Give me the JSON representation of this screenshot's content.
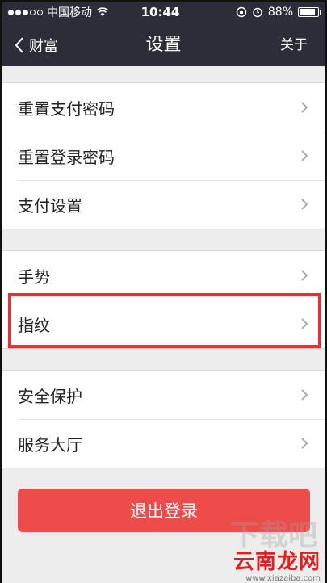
{
  "statusbar": {
    "carrier": "中国移动",
    "time": "10:44",
    "battery": "88%",
    "battery_level": 0.88
  },
  "navbar": {
    "back_label": "财富",
    "title": "设置",
    "about_label": "关于"
  },
  "groups": [
    {
      "items": [
        {
          "label": "重置支付密码"
        },
        {
          "label": "重置登录密码"
        },
        {
          "label": "支付设置"
        }
      ]
    },
    {
      "items": [
        {
          "label": "手势"
        },
        {
          "label": "指纹"
        }
      ]
    },
    {
      "items": [
        {
          "label": "安全保护"
        },
        {
          "label": "服务大厅"
        }
      ]
    }
  ],
  "logout_label": "退出登录",
  "watermark": {
    "text": "云南龙网",
    "url": "www.xiazaiba.com"
  }
}
